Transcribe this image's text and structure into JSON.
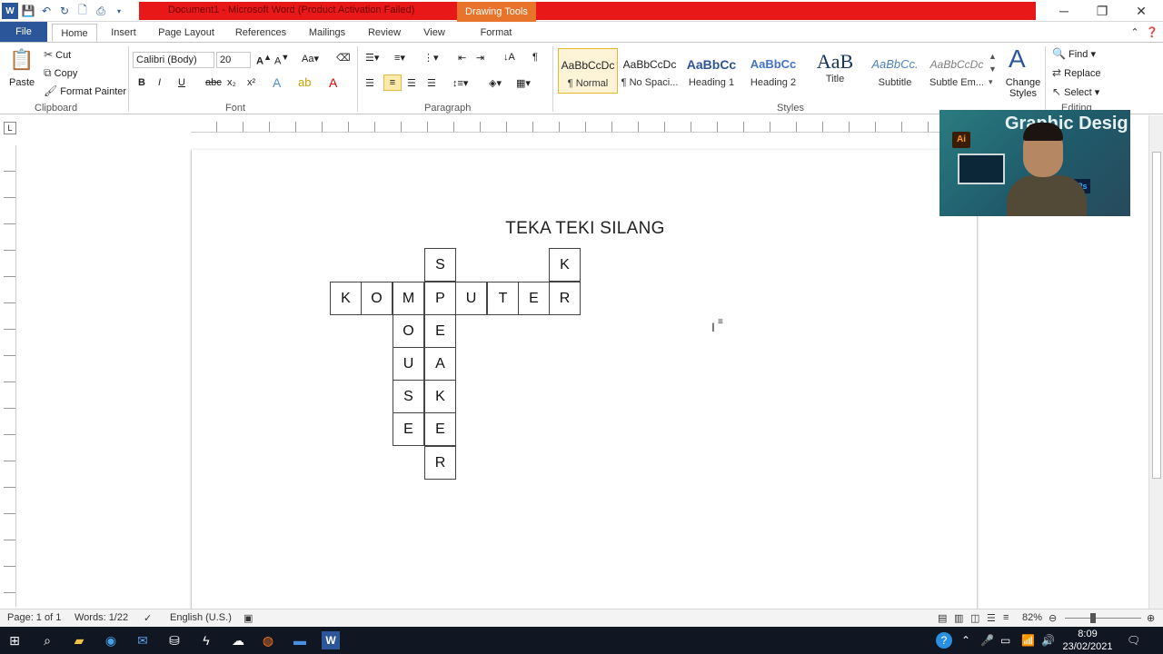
{
  "window": {
    "title": "Document1 - Microsoft Word (Product Activation Failed)",
    "context_tab_group": "Drawing Tools",
    "minimize": "─",
    "maximize": "❐",
    "close": "✕"
  },
  "tabs": [
    {
      "label": "File"
    },
    {
      "label": "Home"
    },
    {
      "label": "Insert"
    },
    {
      "label": "Page Layout"
    },
    {
      "label": "References"
    },
    {
      "label": "Mailings"
    },
    {
      "label": "Review"
    },
    {
      "label": "View"
    },
    {
      "label": "Format"
    }
  ],
  "ribbon": {
    "clipboard": {
      "label": "Clipboard",
      "paste": "Paste",
      "cut": "Cut",
      "copy": "Copy",
      "format_painter": "Format Painter"
    },
    "font": {
      "label": "Font",
      "font_name": "Calibri (Body)",
      "font_size": "20"
    },
    "paragraph": {
      "label": "Paragraph"
    },
    "styles": {
      "label": "Styles",
      "items": [
        {
          "sample": "AaBbCcDc",
          "name": "¶ Normal"
        },
        {
          "sample": "AaBbCcDc",
          "name": "¶ No Spaci..."
        },
        {
          "sample": "AaBbCc",
          "name": "Heading 1"
        },
        {
          "sample": "AaBbCc",
          "name": "Heading 2"
        },
        {
          "sample": "AaB",
          "name": "Title"
        },
        {
          "sample": "AaBbCc.",
          "name": "Subtitle"
        },
        {
          "sample": "AaBbCcDc",
          "name": "Subtle Em..."
        }
      ],
      "change_styles": "Change Styles"
    },
    "editing": {
      "label": "Editing",
      "find": "Find",
      "replace": "Replace",
      "select": "Select"
    }
  },
  "document": {
    "heading": "TEKA TEKI SILANG",
    "across_word": "KOMPUTER",
    "cells": [
      {
        "letter": "S"
      },
      {
        "letter": "K"
      },
      {
        "letter": "K"
      },
      {
        "letter": "O"
      },
      {
        "letter": "M"
      },
      {
        "letter": "P"
      },
      {
        "letter": "U"
      },
      {
        "letter": "T"
      },
      {
        "letter": "E"
      },
      {
        "letter": "R"
      },
      {
        "letter": "O"
      },
      {
        "letter": "E"
      },
      {
        "letter": "U"
      },
      {
        "letter": "A"
      },
      {
        "letter": "S"
      },
      {
        "letter": "K"
      },
      {
        "letter": "E"
      },
      {
        "letter": "E"
      },
      {
        "letter": "R"
      }
    ]
  },
  "webcam": {
    "overlay_title": "Graphic Desig",
    "ai_badge": "Ai",
    "ps_badge": "Ps"
  },
  "statusbar": {
    "page": "Page: 1 of 1",
    "words": "Words: 1/22",
    "language": "English (U.S.)",
    "zoom": "82%"
  },
  "taskbar": {
    "time": "8:09",
    "date": "23/02/2021"
  },
  "colors": {
    "title_red": "#e81818",
    "drawing_tools": "#e8732a",
    "file_tab": "#2b579a",
    "taskbar": "#101622"
  }
}
